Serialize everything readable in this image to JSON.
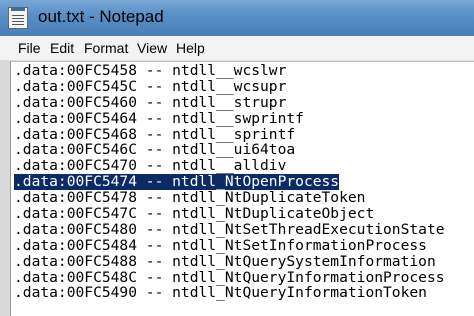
{
  "window": {
    "title": "out.txt - Notepad",
    "titlebar_color": "#5a8fc7",
    "icon": "notepad-icon"
  },
  "menu": {
    "items": [
      "File",
      "Edit",
      "Format",
      "View",
      "Help"
    ]
  },
  "editor": {
    "selection_color": "#0c2a63",
    "selected_line_index": 7,
    "lines": [
      ".data:00FC5458 -- ntdll__wcslwr",
      ".data:00FC545C -- ntdll__wcsupr",
      ".data:00FC5460 -- ntdll__strupr",
      ".data:00FC5464 -- ntdll__swprintf",
      ".data:00FC5468 -- ntdll__sprintf",
      ".data:00FC546C -- ntdll__ui64toa",
      ".data:00FC5470 -- ntdll__alldiv",
      ".data:00FC5474 -- ntdll_NtOpenProcess",
      ".data:00FC5478 -- ntdll_NtDuplicateToken",
      ".data:00FC547C -- ntdll_NtDuplicateObject",
      ".data:00FC5480 -- ntdll_NtSetThreadExecutionState",
      ".data:00FC5484 -- ntdll_NtSetInformationProcess",
      ".data:00FC5488 -- ntdll_NtQuerySystemInformation",
      ".data:00FC548C -- ntdll_NtQueryInformationProcess",
      ".data:00FC5490 -- ntdll_NtQueryInformationToken"
    ]
  }
}
